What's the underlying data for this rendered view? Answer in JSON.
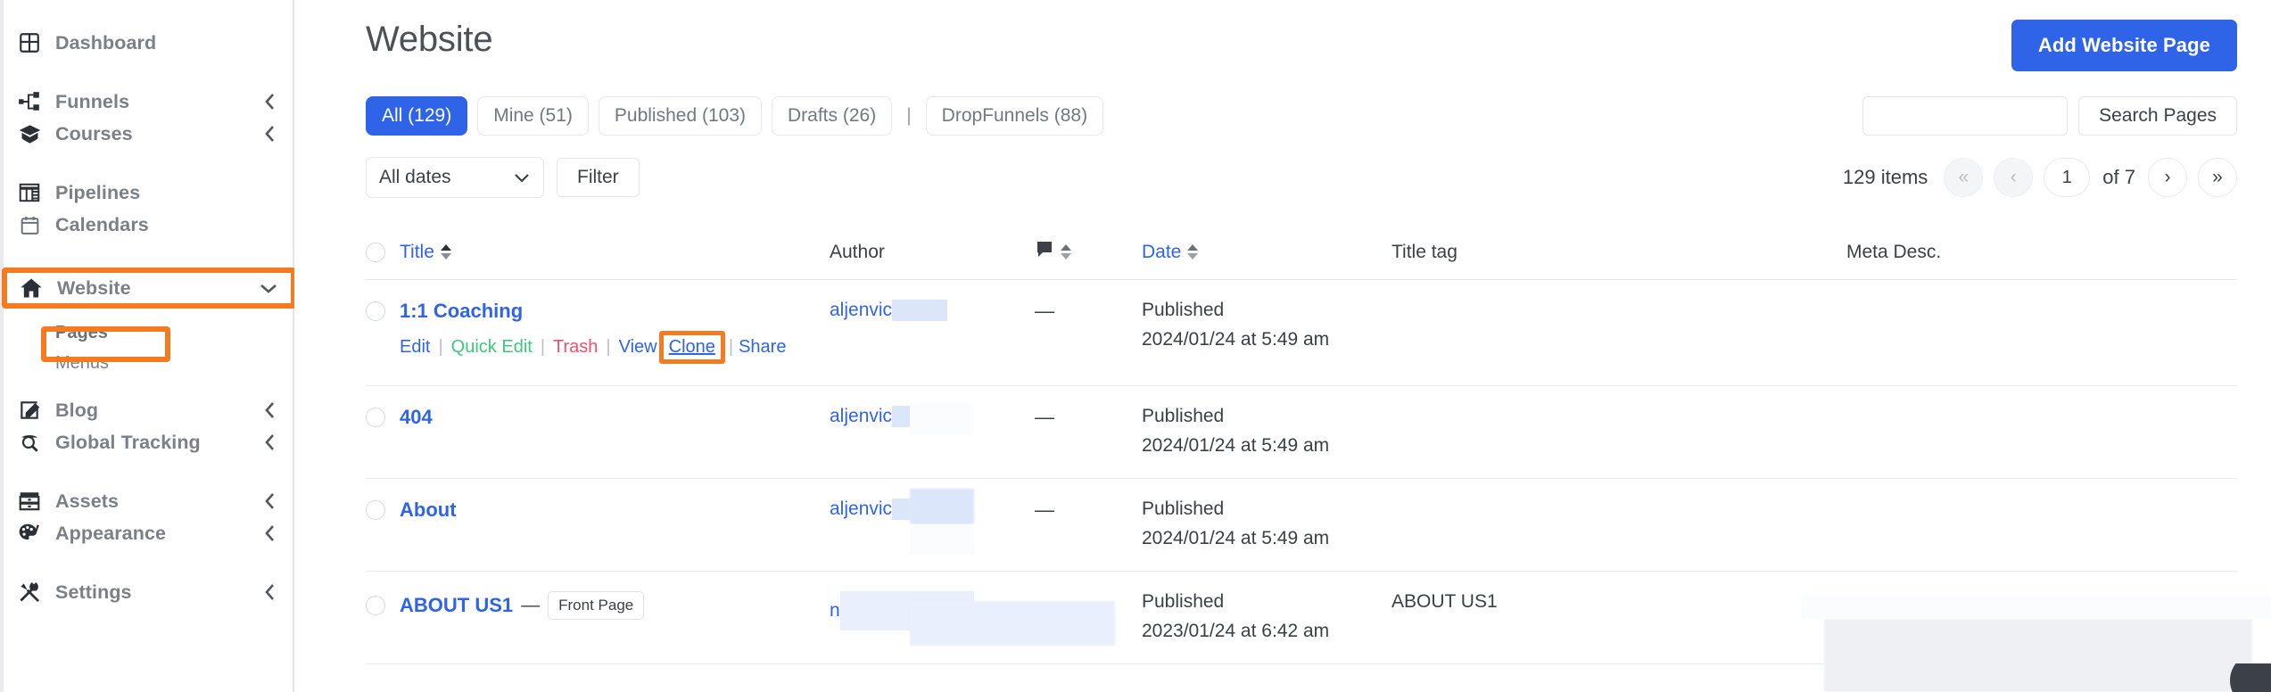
{
  "sidebar": {
    "groups": [
      {
        "items": [
          {
            "label": "Dashboard",
            "icon": "dashboard-icon",
            "chevron": false
          }
        ]
      },
      {
        "items": [
          {
            "label": "Funnels",
            "icon": "funnels-icon",
            "chevron": true
          },
          {
            "label": "Courses",
            "icon": "courses-icon",
            "chevron": true
          }
        ]
      },
      {
        "items": [
          {
            "label": "Pipelines",
            "icon": "pipelines-icon",
            "chevron": false
          },
          {
            "label": "Calendars",
            "icon": "calendar-icon",
            "chevron": false
          }
        ]
      },
      {
        "items": [
          {
            "label": "Blog",
            "icon": "blog-icon",
            "chevron": true
          },
          {
            "label": "Global Tracking",
            "icon": "global-tracking-icon",
            "chevron": true
          }
        ]
      },
      {
        "items": [
          {
            "label": "Assets",
            "icon": "assets-icon",
            "chevron": true
          },
          {
            "label": "Appearance",
            "icon": "appearance-icon",
            "chevron": true
          }
        ]
      },
      {
        "items": [
          {
            "label": "Settings",
            "icon": "settings-icon",
            "chevron": true
          }
        ]
      }
    ],
    "website": {
      "label": "Website",
      "icon": "home-icon",
      "chevron_down": true
    },
    "subitems": [
      {
        "label": "Pages",
        "active": true
      },
      {
        "label": "Menus",
        "active": false
      }
    ],
    "highlight_color": "#f47b20"
  },
  "header": {
    "title": "Website",
    "add_button": "Add Website Page",
    "accent": "#2f64e8"
  },
  "tabs": [
    {
      "label": "All (129)",
      "active": true
    },
    {
      "label": "Mine (51)",
      "active": false
    },
    {
      "label": "Published (103)",
      "active": false
    },
    {
      "label": "Drafts (26)",
      "active": false
    },
    {
      "label": "DropFunnels (88)",
      "active": false
    }
  ],
  "tab_separator": "|",
  "search": {
    "value": "",
    "placeholder": "",
    "button": "Search Pages"
  },
  "filters": {
    "date_select": "All dates",
    "filter_button": "Filter"
  },
  "pager": {
    "count": "129 items",
    "first": "«",
    "prev": "‹",
    "current": "1",
    "of": "of 7",
    "next": "›",
    "last": "»"
  },
  "table": {
    "headers": {
      "title": "Title",
      "author": "Author",
      "comments": "comment-icon",
      "date": "Date",
      "title_tag": "Title tag",
      "meta_desc": "Meta Desc."
    },
    "rows": [
      {
        "title": "1:1 Coaching",
        "badge": "",
        "author": "aljenvic",
        "comments": "—",
        "date_status": "Published",
        "date_value": "2024/01/24 at 5:49 am",
        "title_tag": "",
        "meta_desc": "",
        "actions": [
          {
            "label": "Edit",
            "color": "blue"
          },
          {
            "label": "Quick Edit",
            "color": "green"
          },
          {
            "label": "Trash",
            "color": "red"
          },
          {
            "label": "View",
            "color": "blue"
          },
          {
            "label": "Clone",
            "color": "blue",
            "highlighted": true
          },
          {
            "label": "Share",
            "color": "blue"
          }
        ]
      },
      {
        "title": "404",
        "badge": "",
        "author": "aljenvic",
        "comments": "—",
        "date_status": "Published",
        "date_value": "2024/01/24 at 5:49 am",
        "title_tag": "",
        "meta_desc": "",
        "actions": []
      },
      {
        "title": "About",
        "badge": "",
        "author": "aljenvic",
        "comments": "—",
        "date_status": "Published",
        "date_value": "2024/01/24 at 5:49 am",
        "title_tag": "",
        "meta_desc": "",
        "actions": []
      },
      {
        "title": "ABOUT US1",
        "badge": "Front Page",
        "badge_dash": "—",
        "author": "n",
        "comments": "—",
        "date_status": "Published",
        "date_value": "2023/01/24 at 6:42 am",
        "title_tag": "ABOUT US1",
        "meta_desc": "",
        "actions": []
      }
    ]
  }
}
